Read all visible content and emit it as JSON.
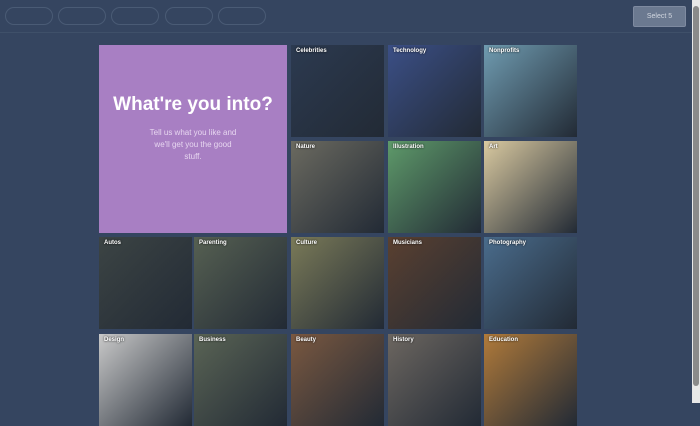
{
  "header": {
    "select_button": "Select 5"
  },
  "hero": {
    "title": "What're you into?",
    "subtitle": "Tell us what you like and we'll get you the good stuff."
  },
  "tiles": [
    {
      "label": "Celebrities",
      "color": "#2c3a50"
    },
    {
      "label": "Technology",
      "color": "#3b4f86"
    },
    {
      "label": "Nonprofits",
      "color": "#6f9bb0"
    },
    {
      "label": "Nature",
      "color": "#6b6a60"
    },
    {
      "label": "Illustration",
      "color": "#5e9a6a"
    },
    {
      "label": "Art",
      "color": "#d9c9a0"
    },
    {
      "label": "Autos",
      "color": "#3c4444"
    },
    {
      "label": "Parenting",
      "color": "#566052"
    },
    {
      "label": "Culture",
      "color": "#7a7a58"
    },
    {
      "label": "Musicians",
      "color": "#5a4030"
    },
    {
      "label": "Photography",
      "color": "#4a6c8c"
    },
    {
      "label": "Design",
      "color": "#c9c9c9"
    },
    {
      "label": "Business",
      "color": "#5a6455"
    },
    {
      "label": "Beauty",
      "color": "#7a5840"
    },
    {
      "label": "History",
      "color": "#6c6660"
    },
    {
      "label": "Education",
      "color": "#b07a3a"
    }
  ]
}
